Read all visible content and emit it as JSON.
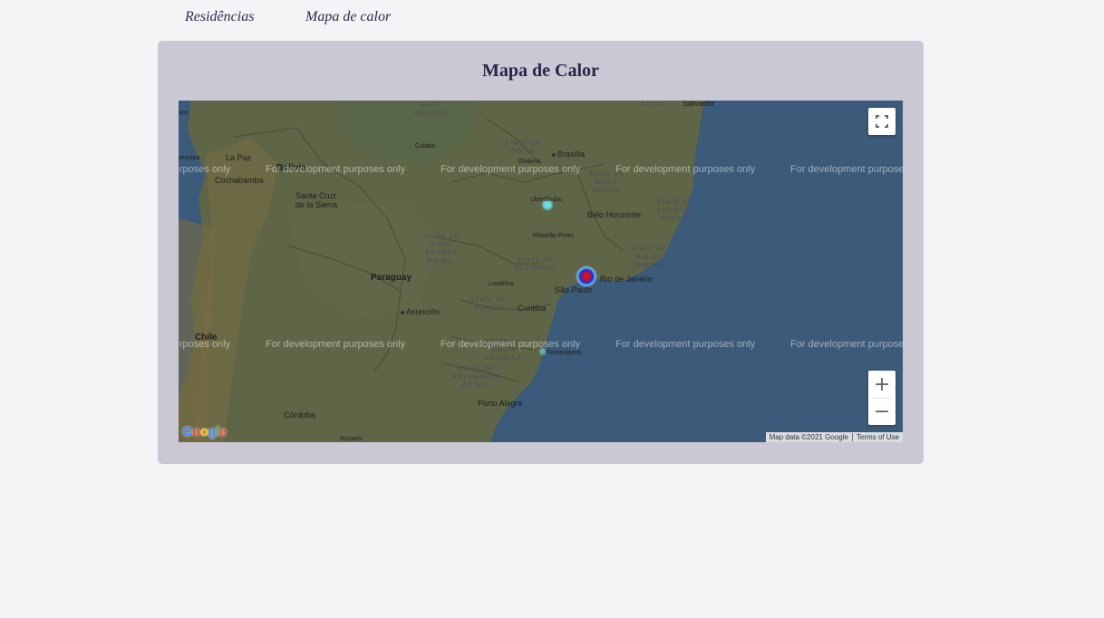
{
  "nav": {
    "items": [
      {
        "label": "Residências"
      },
      {
        "label": "Mapa de calor"
      }
    ]
  },
  "card": {
    "title": "Mapa de Calor"
  },
  "map": {
    "watermark": "For development purposes only",
    "attribution": "Map data ©2021 Google",
    "terms": "Terms of Use",
    "logo": "Google",
    "fullscreen_icon": "fullscreen-icon",
    "zoom_in_label": "+",
    "zoom_out_label": "−",
    "colors": {
      "ocean": "#3c5a79",
      "land": "#5f6647",
      "heat_red": "#e01010",
      "heat_blue": "#1a30d0",
      "heat_cyan": "#6ce8f0"
    },
    "labels": {
      "bahia": "BAHIA",
      "salvador": "Salvador",
      "mato_grosso": "MATO\nGROSSO",
      "cuiaba": "Cuiabá",
      "goias": "STATE OF\nGOIÁS",
      "brasilia": "Brasília",
      "goiania": "Goiânia",
      "minas": "STATE OF\nMINAS\nGERAIS",
      "uberlandia": "Uberlândia",
      "belo_horizonte": "Belo Horizonte",
      "espirito_santo": "STATE OF\nESPÍRITO\nSANTO",
      "la_paz": "La Paz",
      "arequipa": "requipa",
      "bolivia": "Bolivia",
      "cochabamba": "Cochabamba",
      "santa_cruz": "Santa Cruz\nde la Sierra",
      "ms": "STATE OF\nMATO\nGROSSO\nDO SUL",
      "ribeirao": "Ribeirão Preto",
      "rio_state": "STATE OF\nRIO DE\nJANEIRO",
      "sp_state": "STATE OF\nSÃO PAULO",
      "rio": "Rio de Janeiro",
      "sao_paulo": "São Paulo",
      "londrina": "Londrina",
      "paraguay": "Paraguay",
      "parana": "STATE OF\nPARANÁ",
      "curitiba": "Curitiba",
      "asuncion": "Asunción",
      "chile": "Chile",
      "sc": "STATE OF\nSANTA\nCATARINA",
      "florianopolis": "Florianópolis",
      "rs": "STATE OF\nRIO GRANDE\nDO SUL",
      "porto_alegre": "Porto Alegre",
      "cordoba": "Córdoba",
      "cusco": "sco",
      "rosario": "Rosario"
    }
  }
}
